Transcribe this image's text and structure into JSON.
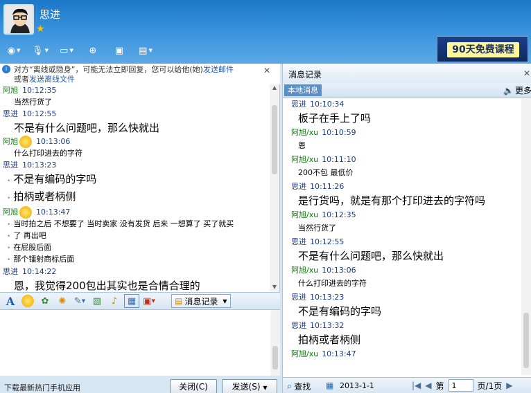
{
  "header": {
    "contact_name": "思进",
    "promo_label": "90天免费课程"
  },
  "notice": {
    "text_before": "对方“离线或隐身”，可能无法立即回复，您可以给他(她)",
    "link_email": "发送邮件",
    "text_or": "或者",
    "link_offline_file": "发送离线文件"
  },
  "chat": {
    "messages": [
      {
        "sender": "阿旭",
        "side": "them",
        "time": "10:12:35",
        "lines": [
          "当然行货了"
        ],
        "size": "small"
      },
      {
        "sender": "思进",
        "side": "me",
        "time": "10:12:55",
        "lines": [
          "不是有什么问题吧，那么快就出"
        ],
        "size": "big"
      },
      {
        "sender": "阿旭",
        "side": "them",
        "time": "10:13:06",
        "lines": [
          "什么打印进去的字符"
        ],
        "size": "small"
      },
      {
        "sender": "思进",
        "side": "me",
        "time": "10:13:23",
        "lines": [
          "不是有编码的字吗",
          "拍柄或者柄侧"
        ],
        "size": "big"
      },
      {
        "sender": "阿旭",
        "side": "them",
        "time": "10:13:47",
        "lines": [
          "当时拍之后  不想要了  当时卖家  没有发货  后来  一想算了  买了就买",
          "了  再出吧",
          "在屁股后面",
          "那个镭射商标后面"
        ],
        "size": "small"
      },
      {
        "sender": "思进",
        "side": "me",
        "time": "10:14:22",
        "lines": [
          "恩，我觉得200包出其实也是合情合理的"
        ],
        "size": "big"
      }
    ]
  },
  "input_toolbar": {
    "msg_record_label": "消息记录"
  },
  "bottom": {
    "mobile_link": "下载最新热门手机应用",
    "close_label": "关闭(C)",
    "send_label": "发送(S)"
  },
  "history": {
    "title": "消息记录",
    "tab_local": "本地消息",
    "more_label": "更多",
    "messages": [
      {
        "sender": "思进",
        "side": "me",
        "time": "10:10:34",
        "text": "板子在手上了吗",
        "size": "big"
      },
      {
        "sender": "阿旭/xu",
        "side": "them",
        "time": "10:10:59",
        "text": "恩",
        "size": "small"
      },
      {
        "sender": "阿旭/xu",
        "side": "them",
        "time": "10:11:10",
        "text": "200不包 最低价",
        "size": "small"
      },
      {
        "sender": "思进",
        "side": "me",
        "time": "10:11:26",
        "text": "是行货吗，就是有那个打印进去的字符吗",
        "size": "big"
      },
      {
        "sender": "阿旭/xu",
        "side": "them",
        "time": "10:12:35",
        "text": "当然行货了",
        "size": "small"
      },
      {
        "sender": "思进",
        "side": "me",
        "time": "10:12:55",
        "text": "不是有什么问题吧，那么快就出",
        "size": "big"
      },
      {
        "sender": "阿旭/xu",
        "side": "them",
        "time": "10:13:06",
        "text": "什么打印进去的字符",
        "size": "small"
      },
      {
        "sender": "思进",
        "side": "me",
        "time": "10:13:23",
        "text": "不是有编码的字吗",
        "size": "big"
      },
      {
        "sender": "思进",
        "side": "me",
        "time": "10:13:32",
        "text": "拍柄或者柄侧",
        "size": "big"
      },
      {
        "sender": "阿旭/xu",
        "side": "them",
        "time": "10:13:47",
        "text": "",
        "size": "small"
      }
    ],
    "footer": {
      "search_label": "查找",
      "date": "2013-1-1",
      "page_prefix": "第",
      "page_value": "1",
      "page_suffix": "页/1页"
    }
  }
}
